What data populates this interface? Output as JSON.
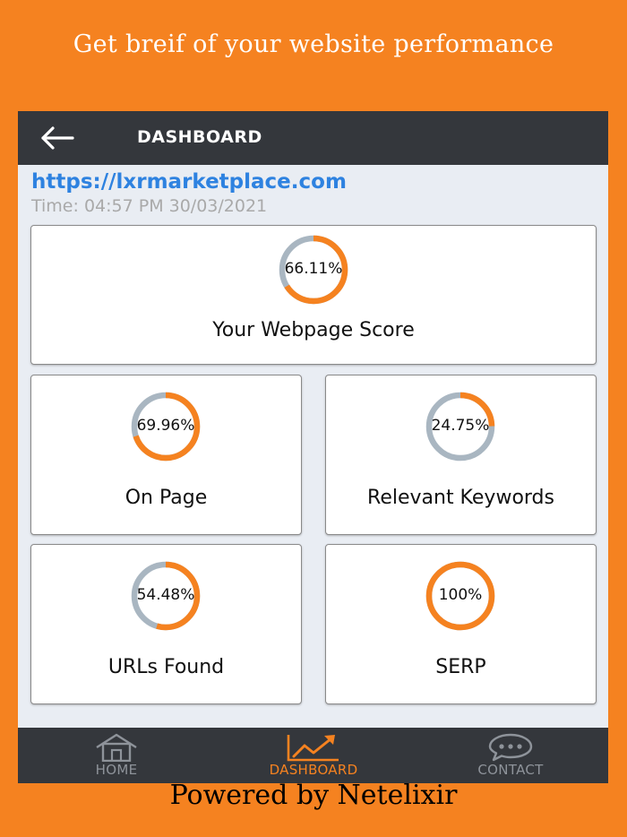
{
  "promo": {
    "title": "Get breif of your website performance"
  },
  "appbar": {
    "title": "DASHBOARD",
    "back_icon": "back-arrow-icon"
  },
  "site": {
    "url": "https://lxrmarketplace.com",
    "time": "Time: 04:57 PM  30/03/2021"
  },
  "colors": {
    "accent": "#f58220",
    "ring_track": "#a9b6c1",
    "appbar": "#34373c",
    "link": "#2e82e0"
  },
  "cards": {
    "score": {
      "value": 66.11,
      "value_label": "66.11%",
      "label": "Your Webpage Score"
    },
    "on_page": {
      "value": 69.96,
      "value_label": "69.96%",
      "label": "On Page"
    },
    "keywords": {
      "value": 24.75,
      "value_label": "24.75%",
      "label": "Relevant Keywords"
    },
    "urls": {
      "value": 54.48,
      "value_label": "54.48%",
      "label": "URLs Found"
    },
    "serp": {
      "value": 100,
      "value_label": "100%",
      "label": "SERP"
    }
  },
  "nav": {
    "home": {
      "label": "HOME",
      "icon": "home-icon",
      "active": false
    },
    "dashboard": {
      "label": "DASHBOARD",
      "icon": "trend-chart-icon",
      "active": true
    },
    "contact": {
      "label": "CONTACT",
      "icon": "chat-bubble-icon",
      "active": false
    }
  },
  "footer": {
    "text": "Powered by Netelixir"
  }
}
